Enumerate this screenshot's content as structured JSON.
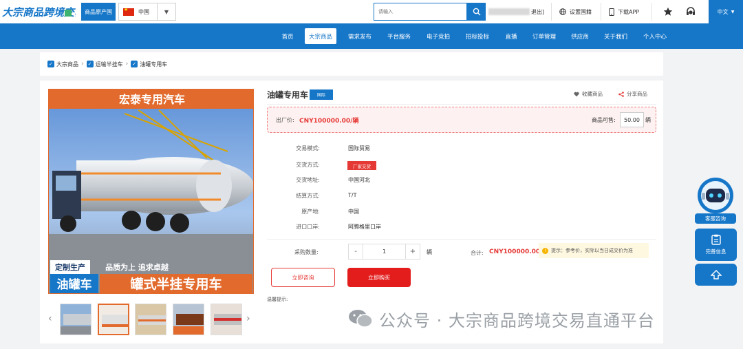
{
  "header": {
    "logo_text": "大宗商品跨境交易",
    "origin_button": "商品原产国",
    "country": "中国",
    "search_placeholder": "请输入",
    "logout": "退出]",
    "set_country": "设置国籍",
    "download_app": "下载APP",
    "language": "中文"
  },
  "nav": {
    "items": [
      {
        "label": "首页"
      },
      {
        "label": "大宗商品"
      },
      {
        "label": "需求发布"
      },
      {
        "label": "平台服务"
      },
      {
        "label": "电子竞拍"
      },
      {
        "label": "招标投标"
      },
      {
        "label": "直播"
      },
      {
        "label": "订单管理"
      },
      {
        "label": "供应商"
      },
      {
        "label": "关于我们"
      },
      {
        "label": "个人中心"
      }
    ],
    "active": "大宗商品"
  },
  "breadcrumb": [
    "大宗商品",
    "运输半挂车",
    "油罐专用车"
  ],
  "product": {
    "title": "油罐专用车",
    "badge": "国际",
    "favorite": "收藏商品",
    "share": "分享商品",
    "image_texts": {
      "banner": "宏泰专用汽车",
      "tag1": "定制生产",
      "tag2": "油罐车",
      "slogan": "品质为上 追求卓越",
      "big": "罐式半挂专用车"
    },
    "price": {
      "label": "出厂价:",
      "value": "CNY100000.00/辆",
      "stock_label": "商品可售:",
      "stock_value": "50.00",
      "stock_unit": "辆"
    },
    "attributes": [
      {
        "label": "交易模式:",
        "value": "国际贸易"
      },
      {
        "label": "交货方式:",
        "value": "厂家交货"
      },
      {
        "label": "交货地址:",
        "value": "中国河北"
      },
      {
        "label": "结算方式:",
        "value": "T/T"
      },
      {
        "label": "原产地:",
        "value": "中国"
      },
      {
        "label": "进口口岸:",
        "value": "阿腾格里口岸"
      }
    ],
    "quantity": {
      "label": "采购数量:",
      "minus": "-",
      "value": "1",
      "plus": "+",
      "unit": "辆"
    },
    "total": {
      "label": "合计:",
      "value": "CNY100000.00"
    },
    "tip": "提示：参考价，实际以当日成交价为准",
    "consult_button": "立即咨询",
    "buy_button": "立即购买",
    "warm_tip": "温馨提示:"
  },
  "watermark": "公众号 · 大宗商品跨境交易直通平台",
  "side": {
    "service": "客服咨询",
    "complete_info": "完善信息"
  },
  "colors": {
    "primary": "#1677c9",
    "red": "#e53935",
    "orange": "#e26a2c"
  }
}
